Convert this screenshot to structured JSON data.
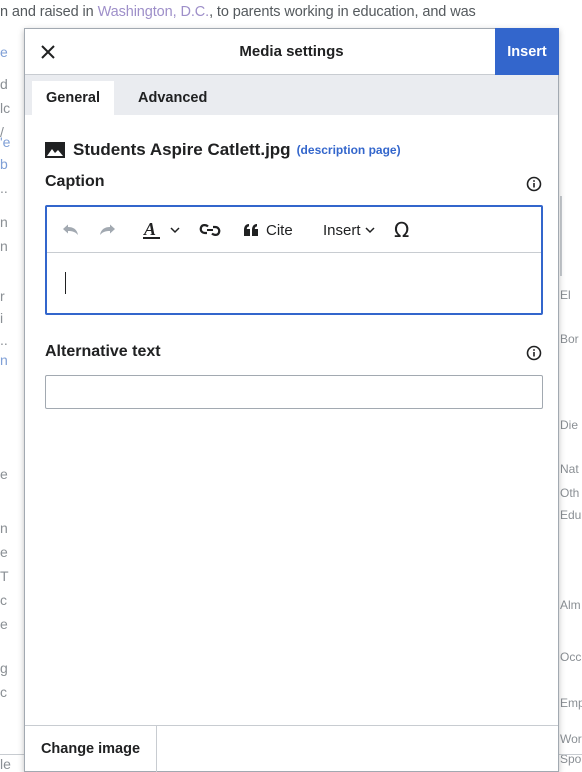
{
  "background": {
    "top_line_before": "n and raised in ",
    "top_line_link": "Washington, D.C.",
    "top_line_after": ", to parents working in education, and was",
    "left_fragments": [
      "e",
      "d",
      "lc",
      "/",
      "'e",
      "b",
      "..",
      "n",
      "n",
      "r",
      "i",
      "..",
      "n",
      "e",
      "n",
      "e",
      "T",
      "c",
      "e",
      "g",
      "c",
      "le"
    ],
    "right_fragments": [
      "El",
      "Bor",
      "Die",
      "Nat",
      "Oth",
      "Edu",
      "Alm",
      "Occ",
      "Emp",
      "Wor",
      "Spo"
    ]
  },
  "dialog": {
    "title": "Media settings",
    "close_icon": "close-icon",
    "insert_label": "Insert",
    "tabs": [
      {
        "label": "General",
        "active": true
      },
      {
        "label": "Advanced",
        "active": false
      }
    ],
    "file": {
      "icon": "image-icon",
      "name": "Students Aspire Catlett.jpg",
      "description_link": "(description page)"
    },
    "caption": {
      "label": "Caption",
      "info_icon": "info-icon",
      "toolbar": {
        "undo_icon": "undo-icon",
        "redo_icon": "redo-icon",
        "text_style_icon": "text-style-icon",
        "link_icon": "link-icon",
        "cite_label": "Cite",
        "insert_label": "Insert",
        "special_char_icon": "omega-icon"
      },
      "value": ""
    },
    "alt_text": {
      "label": "Alternative text",
      "info_icon": "info-icon",
      "value": ""
    },
    "footer": {
      "change_image_label": "Change image"
    }
  },
  "colors": {
    "accent": "#3366cc",
    "tab_bar": "#eaecf0",
    "border": "#a2a9b1",
    "text": "#202122"
  }
}
